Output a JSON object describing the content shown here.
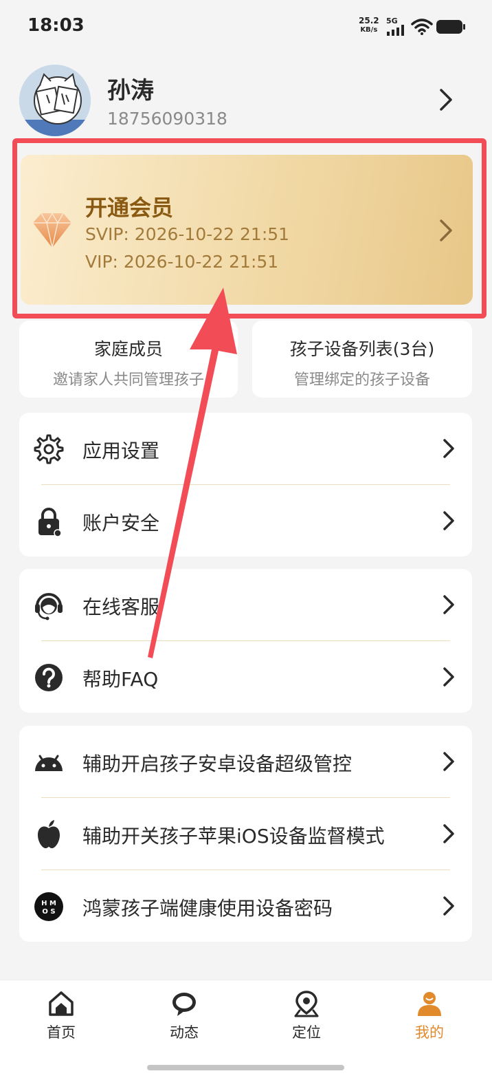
{
  "status_bar": {
    "time": "18:03",
    "speed_value": "25.2",
    "speed_unit": "KB/s",
    "network": "5G"
  },
  "profile": {
    "name": "孙涛",
    "phone": "18756090318"
  },
  "vip": {
    "title": "开通会员",
    "svip": "SVIP: 2026-10-22 21:51",
    "vip": "VIP: 2026-10-22 21:51"
  },
  "cards": [
    {
      "title": "家庭成员",
      "subtitle": "邀请家人共同管理孩子"
    },
    {
      "title": "孩子设备列表(3台)",
      "subtitle": "管理绑定的孩子设备"
    }
  ],
  "groups": [
    {
      "items": [
        {
          "icon": "gear-icon",
          "label": "应用设置"
        },
        {
          "icon": "lock-icon",
          "label": "账户安全"
        }
      ]
    },
    {
      "items": [
        {
          "icon": "headset-icon",
          "label": "在线客服"
        },
        {
          "icon": "question-icon",
          "label": "帮助FAQ"
        }
      ]
    },
    {
      "items": [
        {
          "icon": "android-icon",
          "label": "辅助开启孩子安卓设备超级管控"
        },
        {
          "icon": "apple-icon",
          "label": "辅助开关孩子苹果iOS设备监督模式"
        },
        {
          "icon": "hmos-icon",
          "label": "鸿蒙孩子端健康使用设备密码"
        }
      ]
    }
  ],
  "nav": [
    {
      "label": "首页",
      "icon": "home-icon"
    },
    {
      "label": "动态",
      "icon": "chat-bubble-icon"
    },
    {
      "label": "定位",
      "icon": "location-pin-icon"
    },
    {
      "label": "我的",
      "icon": "person-icon",
      "active": true
    }
  ],
  "colors": {
    "accent": "#e08a2c",
    "highlight": "#f24d57",
    "vip_text": "#8a5a12"
  }
}
